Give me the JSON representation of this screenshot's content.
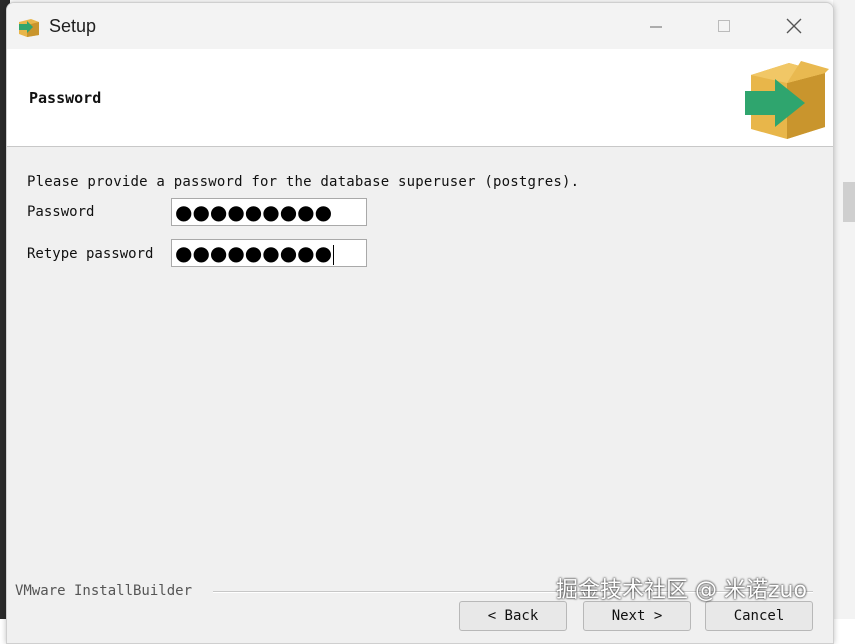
{
  "window": {
    "title": "Setup"
  },
  "header": {
    "title": "Password"
  },
  "content": {
    "instruction": "Please provide a password for the database superuser (postgres).",
    "password_label": "Password",
    "password_value": "●●●●●●●●●",
    "retype_label": "Retype password",
    "retype_value": "●●●●●●●●●"
  },
  "footer": {
    "brand": "VMware InstallBuilder",
    "back_label": "< Back",
    "next_label": "Next >",
    "cancel_label": "Cancel"
  },
  "watermark": "掘金技术社区 @ 米诺zuo",
  "colors": {
    "box_body": "#e8b64a",
    "box_dark": "#c9952d",
    "arrow": "#2fa56e"
  }
}
